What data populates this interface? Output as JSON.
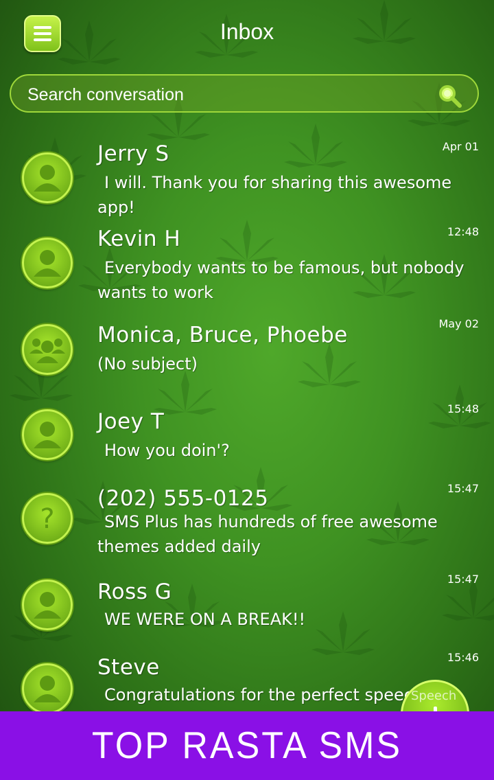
{
  "header": {
    "title": "Inbox",
    "menu_icon": "hamburger-icon"
  },
  "search": {
    "placeholder": "Search conversation",
    "icon": "search-icon"
  },
  "conversations": [
    {
      "name": "Jerry S",
      "time": "Apr 01",
      "snippet": "I will. Thank you for sharing this awesome app!",
      "avatar": "person-icon"
    },
    {
      "name": "Kevin H",
      "time": "12:48",
      "snippet": "Everybody wants to be famous, but nobody wants to work",
      "avatar": "person-icon"
    },
    {
      "name": "Monica, Bruce, Phoebe",
      "time": "May 02",
      "snippet": "(No subject)",
      "avatar": "group-icon"
    },
    {
      "name": "Joey T",
      "time": "15:48",
      "snippet": "How you doin'?",
      "avatar": "person-icon"
    },
    {
      "name": "(202) 555-0125",
      "time": "15:47",
      "snippet": "SMS Plus has hundreds of free awesome themes added daily",
      "avatar": "unknown-contact-icon"
    },
    {
      "name": "Ross G",
      "time": "15:47",
      "snippet": "WE WERE ON A BREAK!!",
      "avatar": "person-icon"
    },
    {
      "name": "Steve",
      "time": "15:46",
      "snippet": "Congratulations for the perfect speech",
      "avatar": "person-icon"
    }
  ],
  "fab": {
    "label": "Speech",
    "icon": "compose-icon"
  },
  "banner": {
    "text": "TOP RASTA SMS"
  },
  "colors": {
    "accent": "#9fd83a",
    "banner": "#8a10e6",
    "background": "#3f9222"
  }
}
